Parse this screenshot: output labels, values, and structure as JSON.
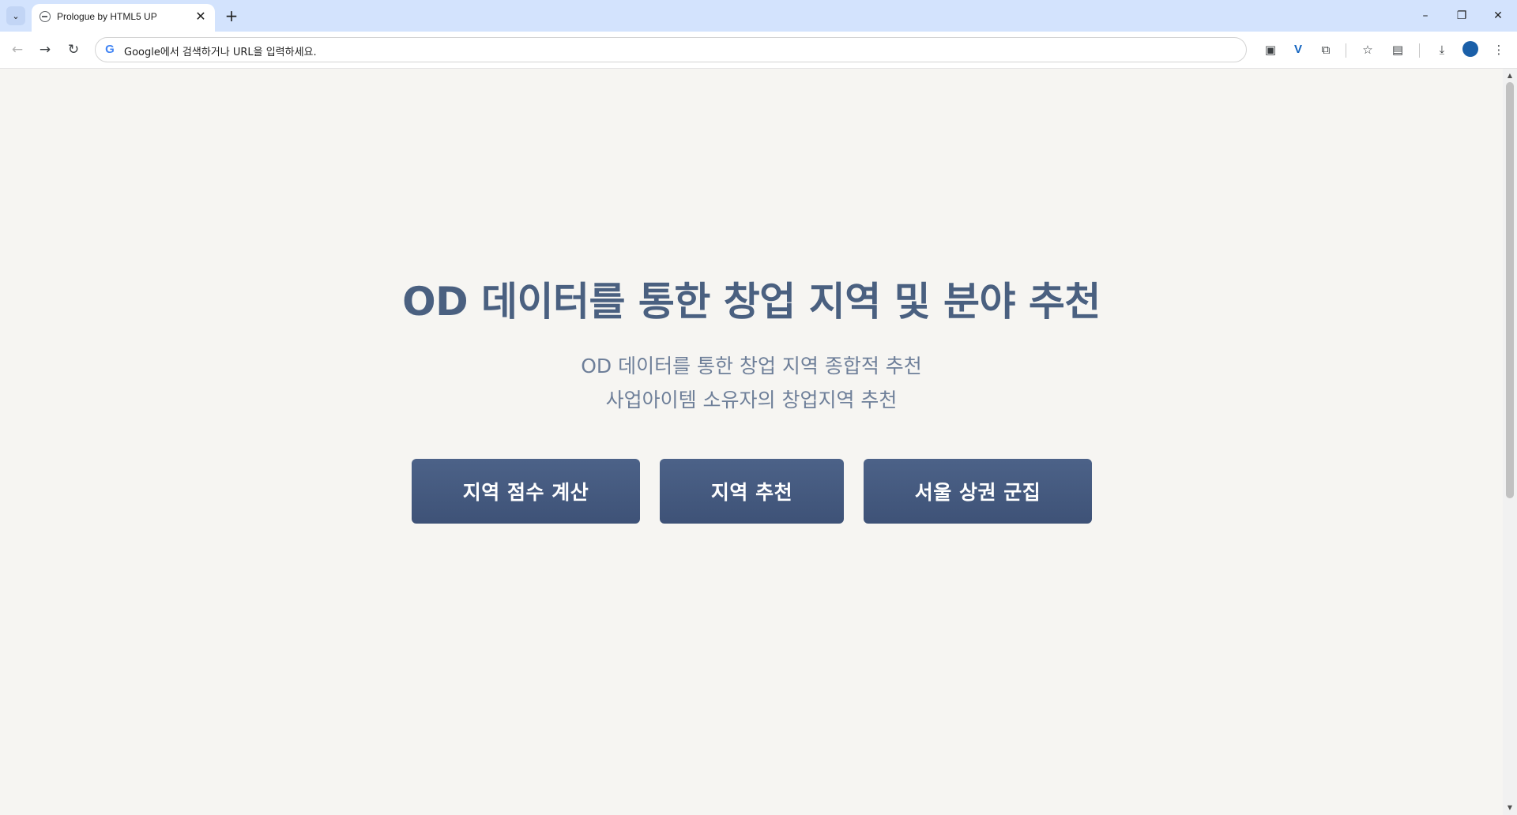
{
  "browser": {
    "tab": {
      "title": "Prologue by HTML5 UP",
      "close_glyph": "✕"
    },
    "tab_search_glyph": "⌄",
    "new_tab_glyph": "+",
    "window_controls": {
      "minimize": "–",
      "restore": "❐",
      "close": "✕"
    },
    "nav": {
      "back": "←",
      "forward": "→",
      "reload": "↻"
    },
    "omnibox": {
      "google_glyph": "G",
      "placeholder": "Google에서 검색하거나 URL을 입력하세요."
    },
    "toolbar_icons": {
      "translate": "▣",
      "extension_v": "V",
      "extensions": "⧉",
      "bookmark": "☆",
      "reading_list": "▤",
      "downloads": "⤓",
      "menu": "⋮"
    }
  },
  "page": {
    "title": "OD 데이터를 통한 창업 지역 및 분야 추천",
    "subtitle_line1": "OD 데이터를 통한 창업 지역 종합적 추천",
    "subtitle_line2": "사업아이템 소유자의 창업지역 추천",
    "buttons": {
      "score": "지역 점수 계산",
      "recommend": "지역 추천",
      "cluster": "서울 상권 군집"
    }
  },
  "scrollbar": {
    "up": "▲",
    "down": "▼"
  },
  "colors": {
    "tabstrip": "#d3e3fd",
    "page_bg": "#f6f5f2",
    "title": "#4a6080",
    "subtitle": "#6e7f99",
    "button": "#44597e"
  }
}
